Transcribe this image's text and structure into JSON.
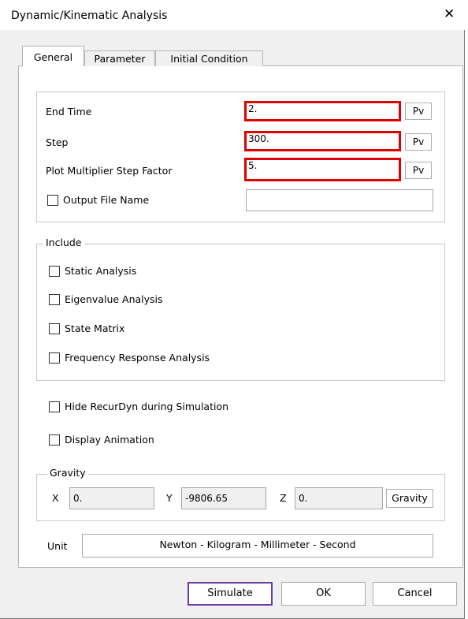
{
  "window": {
    "title": "Dynamic/Kinematic Analysis"
  },
  "tabs": [
    {
      "label": "General"
    },
    {
      "label": "Parameter"
    },
    {
      "label": "Initial Condition"
    }
  ],
  "fields": {
    "end_time": {
      "label": "End Time",
      "value": "2.",
      "pv": "Pv"
    },
    "step": {
      "label": "Step",
      "value": "300.",
      "pv": "Pv"
    },
    "plot_multiplier": {
      "label": "Plot Multiplier Step Factor",
      "value": "5.",
      "pv": "Pv"
    },
    "output_file": {
      "label": "Output File Name",
      "value": ""
    }
  },
  "include": {
    "legend": "Include",
    "items": [
      {
        "label": "Static Analysis"
      },
      {
        "label": "Eigenvalue Analysis"
      },
      {
        "label": "State Matrix"
      },
      {
        "label": "Frequency Response Analysis"
      }
    ]
  },
  "options": {
    "hide_recurdyn": "Hide RecurDyn during Simulation",
    "display_animation": "Display Animation"
  },
  "gravity": {
    "legend": "Gravity",
    "x_label": "X",
    "x_value": "0.",
    "y_label": "Y",
    "y_value": "-9806.65",
    "z_label": "Z",
    "z_value": "0.",
    "button": "Gravity"
  },
  "unit": {
    "label": "Unit",
    "value": "Newton - Kilogram - Millimeter - Second"
  },
  "buttons": {
    "simulate": "Simulate",
    "ok": "OK",
    "cancel": "Cancel"
  },
  "icons": {
    "close": "close-icon"
  }
}
